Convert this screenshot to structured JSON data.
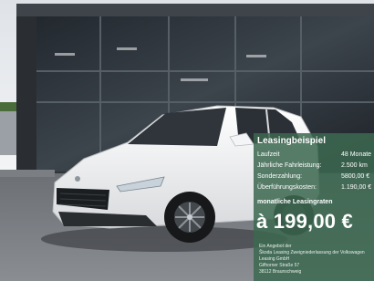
{
  "offer": {
    "title": "Leasingbeispiel",
    "rows": [
      {
        "label": "Laufzeit",
        "value": "48 Monate"
      },
      {
        "label": "Jährliche Fahrleistung:",
        "value": "2.500 km"
      },
      {
        "label": "Sonderzahlung:",
        "value": "5800,00 €"
      },
      {
        "label": "Überführungskosten:",
        "value": "1.190,00 €"
      }
    ],
    "rate_label": "monatliche Leasingraten",
    "price": "à 199,00 €",
    "fine_print": [
      "Ein Angebot der",
      "Škoda Leasing Zweigniederlassung der Volkswagen",
      "Leasing GmbH",
      "Gifhorner Straße 57",
      "38112 Braunschweig"
    ]
  },
  "colors": {
    "overlay": "#3c6950",
    "car": "#f2f3f4",
    "building": "#2a2e33"
  }
}
